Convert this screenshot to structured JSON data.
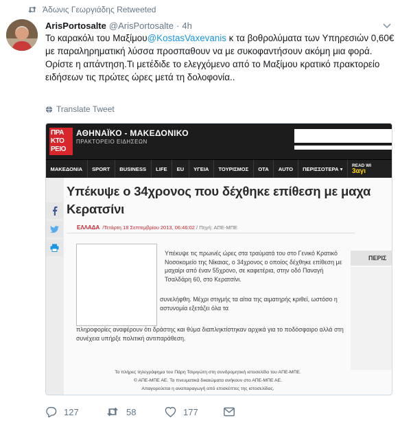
{
  "retweet_banner": {
    "text": "Άδωνις Γεωργιάδης Retweeted"
  },
  "tweet": {
    "author_name": "ArisPortosalte",
    "author_handle": "@ArisPortosalte",
    "separator": "·",
    "time": "4h",
    "text_part1": "Το καρακόλι του Μαξίμου",
    "mention": "@KostasVaxevanis",
    "text_part2": " κ τα βοθρολύματα των Υπηρεσιών 0,60€ με παραληρηματική λύσσα προσπαθουν να με συκοφαντήσουν ακόμη μια φορά.",
    "text_line2": "Ορίστε η απάντηση.Τι μετέδιδε το ελεγχόμενο από το Μαξίμου κρατικό πρακτορείο ειδήσεων τις πρώτες ώρες μετά τη δολοφονία..",
    "translate_label": "Translate Tweet"
  },
  "media": {
    "logo_lines": [
      "ΠΡΑ",
      "ΚΤΟ",
      "ΡΕΙΟ"
    ],
    "site_name": "ΑΘΗΝΑΪΚΟ - ΜΑΚΕΔΟΝΙΚΟ",
    "site_sub": "ΠΡΑΚΤΟΡΕΙΟ ΕΙΔΗΣΕΩΝ",
    "nav": [
      "ΜΑΚΕΔΟΝΙΑ",
      "SPORT",
      "BUSINESS",
      "LIFE",
      "EU",
      "ΥΓΕΙΑ",
      "ΤΟΥΡΙΣΜΟΣ",
      "ΟΤΑ",
      "AUTO",
      "ΠΕΡΙΣΣΟΤΕΡΑ ▾"
    ],
    "read_with_top": "READ WI",
    "read_with_bottom": "3αγι",
    "title_line1": "Υπέκυψε ο 34χρονος που δέχθηκε επίθεση με μαχα",
    "title_line2": "Κερατσίνι",
    "category": "ΕΛΛΑΔΑ",
    "date": "/Τετάρτη 18 Σεπτεμβρίου 2013, 06:46:02",
    "source": " / Πηγή: ΑΠΕ-ΜΠΕ",
    "body1": "Υπέκυψε τις πρωινές ώρες στα τραύματά του στο Γενικό Κρατικό Νοσοκομείο της Νίκαιας, ο 34χρονος ο οποίος δέχθηκε επίθεση με μαχαίρι από έναν 55χρονο, σε καφετέρια, στην οδό Παναγή Τσαλδάρη 60, στο Κερατσίνι.",
    "body2": "συνελήφθη. Μέχρι στιγμής τα αίτια της αιματηρής κριθεί, ωστόσο η αστυνομία εξετάζει όλα τα",
    "body3": "πληροφορίες αναφέρουν ότι δράστης και θύμα διαπληκτίστηκαν αρχικά για το ποδόσφαιρο αλλά στη συνέχεια υπήρξε πολιτική αντιπαράθεση.",
    "sidebar_label": "ΠΕΡΙΣ",
    "footer_lines": [
      "Το πλήρες τηλεγράφημα του Πάρη Τσιριγώτη στη συνδρομητική ιστοσελίδα του ΑΠΕ-ΜΠΕ.",
      "© ΑΠΕ-ΜΠΕ ΑΕ. Τα πνευματικά δικαιώματα ανήκουν στο ΑΠΕ-ΜΠΕ ΑΕ.",
      "Απαγορεύεται η αναπαραγωγή από επισκέπτες της ιστοσελίδας."
    ]
  },
  "actions": {
    "replies": "127",
    "retweets": "58",
    "likes": "177"
  },
  "colors": {
    "link": "#1b95e0",
    "muted": "#657786",
    "brand_red": "#d7262c"
  }
}
